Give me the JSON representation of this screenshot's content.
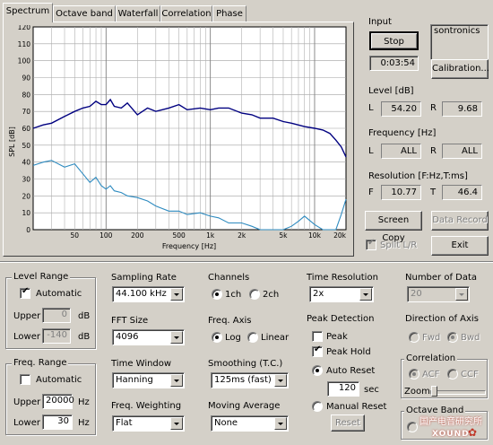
{
  "tabs": [
    "Spectrum",
    "Octave band",
    "Waterfall",
    "Correlation",
    "Phase"
  ],
  "chart": {
    "y_label": "SPL [dB]",
    "x_label": "Frequency [Hz]",
    "y_ticks": [
      "120",
      "110",
      "100",
      "90",
      "80",
      "70",
      "60",
      "50",
      "40",
      "30",
      "20",
      "10",
      "0"
    ],
    "x_ticks": [
      "50",
      "100",
      "200",
      "500",
      "1k",
      "2k",
      "5k",
      "10k",
      "20k"
    ]
  },
  "chart_data": {
    "type": "line",
    "xscale": "log",
    "xlim": [
      20,
      20000
    ],
    "ylim": [
      0,
      120
    ],
    "xlabel": "Frequency [Hz]",
    "ylabel": "SPL [dB]",
    "grid": true,
    "series": [
      {
        "color": "#000080",
        "x": [
          20,
          25,
          30,
          40,
          50,
          60,
          70,
          80,
          90,
          100,
          110,
          120,
          140,
          160,
          200,
          250,
          300,
          400,
          500,
          600,
          800,
          1000,
          1200,
          1500,
          2000,
          2500,
          3000,
          4000,
          5000,
          6000,
          8000,
          10000,
          12000,
          14000,
          16000,
          18000,
          20000
        ],
        "y": [
          60,
          62,
          63,
          67,
          70,
          72,
          73,
          76,
          74,
          74,
          77,
          73,
          72,
          75,
          68,
          72,
          70,
          72,
          74,
          71,
          72,
          71,
          72,
          72,
          69,
          68,
          66,
          66,
          64,
          63,
          61,
          60,
          59,
          57,
          53,
          49,
          43
        ]
      },
      {
        "color": "#2e8bc0",
        "x": [
          20,
          25,
          30,
          40,
          50,
          60,
          70,
          80,
          90,
          100,
          110,
          120,
          140,
          160,
          200,
          250,
          300,
          400,
          500,
          600,
          800,
          1000,
          1200,
          1500,
          2000,
          2500,
          3000,
          4000,
          5000,
          6000,
          7000,
          8000,
          10000,
          12000,
          14000,
          16000,
          18000,
          20000
        ],
        "y": [
          38,
          40,
          41,
          37,
          39,
          33,
          28,
          31,
          26,
          24,
          26,
          23,
          22,
          20,
          19,
          17,
          14,
          11,
          11,
          9,
          10,
          8,
          7,
          4,
          4,
          2,
          0,
          0,
          0,
          2,
          5,
          8,
          3,
          0,
          0,
          0,
          9,
          18
        ]
      }
    ]
  },
  "input": {
    "title": "Input",
    "stop_label": "Stop",
    "device": "sontronics",
    "time": "0:03:54",
    "calibration_label": "Calibration..."
  },
  "level": {
    "title": "Level [dB]",
    "l_label": "L",
    "l_value": "54.20",
    "r_label": "R",
    "r_value": "9.68"
  },
  "frequency": {
    "title": "Frequency [Hz]",
    "l_label": "L",
    "l_value": "ALL",
    "r_label": "R",
    "r_value": "ALL"
  },
  "resolution": {
    "title": "Resolution [F:Hz,T:ms]",
    "f_label": "F",
    "f_value": "10.77",
    "t_label": "T",
    "t_value": "46.4"
  },
  "buttons": {
    "screen_copy": "Screen Copy",
    "data_record": "Data Record",
    "split_lr": "Split L/R",
    "exit": "Exit"
  },
  "level_range": {
    "title": "Level Range",
    "automatic": "Automatic",
    "upper_label": "Upper",
    "upper_value": "0",
    "lower_label": "Lower",
    "lower_value": "-140",
    "unit": "dB"
  },
  "freq_range": {
    "title": "Freq. Range",
    "automatic": "Automatic",
    "upper_label": "Upper",
    "upper_value": "20000",
    "lower_label": "Lower",
    "lower_value": "30",
    "unit": "Hz"
  },
  "sampling_rate": {
    "title": "Sampling Rate",
    "value": "44.100 kHz"
  },
  "fft_size": {
    "title": "FFT Size",
    "value": "4096"
  },
  "time_window": {
    "title": "Time Window",
    "value": "Hanning"
  },
  "freq_weighting": {
    "title": "Freq. Weighting",
    "value": "Flat"
  },
  "channels": {
    "title": "Channels",
    "opt1": "1ch",
    "opt2": "2ch"
  },
  "freq_axis": {
    "title": "Freq. Axis",
    "opt1": "Log",
    "opt2": "Linear"
  },
  "smoothing": {
    "title": "Smoothing (T.C.)",
    "value": "125ms (fast)"
  },
  "moving_average": {
    "title": "Moving Average",
    "value": "None"
  },
  "time_resolution": {
    "title": "Time Resolution",
    "value": "2x"
  },
  "peak_detection": {
    "title": "Peak Detection",
    "peak": "Peak",
    "peak_hold": "Peak Hold",
    "auto_reset": "Auto Reset",
    "interval": "120",
    "interval_unit": "sec",
    "manual_reset": "Manual Reset",
    "reset_button": "Reset"
  },
  "number_of_data": {
    "title": "Number of Data",
    "value": "20"
  },
  "direction_of_axis": {
    "title": "Direction of Axis",
    "fwd": "Fwd",
    "bwd": "Bwd"
  },
  "correlation": {
    "title": "Correlation",
    "acf": "ACF",
    "ccf": "CCF",
    "zoom": "Zoom"
  },
  "octave_band": {
    "title": "Octave Band"
  },
  "watermark": {
    "line1": "国产电音研究所",
    "line2": "XOUND"
  }
}
